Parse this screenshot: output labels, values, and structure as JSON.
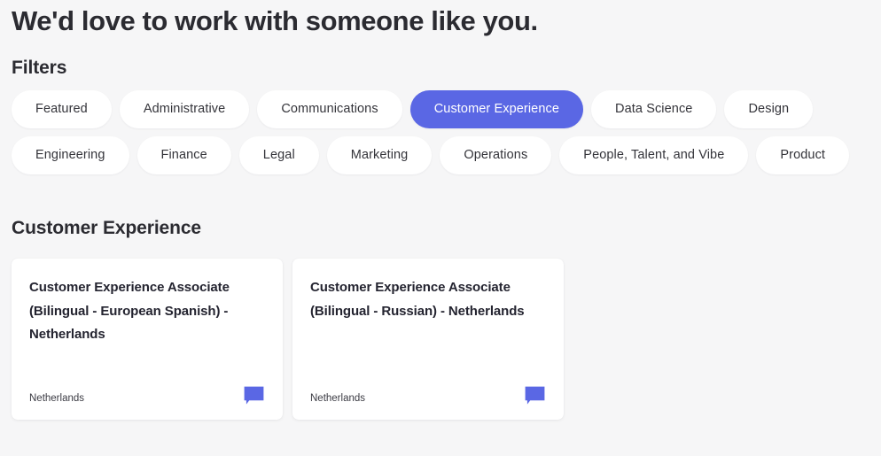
{
  "hero": {
    "title": "We'd love to work with someone like you."
  },
  "filters": {
    "heading": "Filters",
    "selected": "Customer Experience",
    "accent_color": "#5a67e4",
    "rows": [
      [
        {
          "label": "Featured",
          "selected": false
        },
        {
          "label": "Administrative",
          "selected": false
        },
        {
          "label": "Communications",
          "selected": false
        },
        {
          "label": "Customer Experience",
          "selected": true
        },
        {
          "label": "Data Science",
          "selected": false
        },
        {
          "label": "Design",
          "selected": false
        }
      ],
      [
        {
          "label": "Engineering",
          "selected": false
        },
        {
          "label": "Finance",
          "selected": false
        },
        {
          "label": "Legal",
          "selected": false
        },
        {
          "label": "Marketing",
          "selected": false
        },
        {
          "label": "Operations",
          "selected": false
        },
        {
          "label": "People, Talent, and Vibe",
          "selected": false
        },
        {
          "label": "Product",
          "selected": false
        }
      ]
    ]
  },
  "results": {
    "heading": "Customer Experience",
    "cards": [
      {
        "title": "Customer Experience Associate (Bilingual - European Spanish) - Netherlands",
        "location": "Netherlands",
        "icon": "speech-bubble-icon"
      },
      {
        "title": "Customer Experience Associate (Bilingual - Russian) - Netherlands",
        "location": "Netherlands",
        "icon": "speech-bubble-icon"
      }
    ]
  }
}
